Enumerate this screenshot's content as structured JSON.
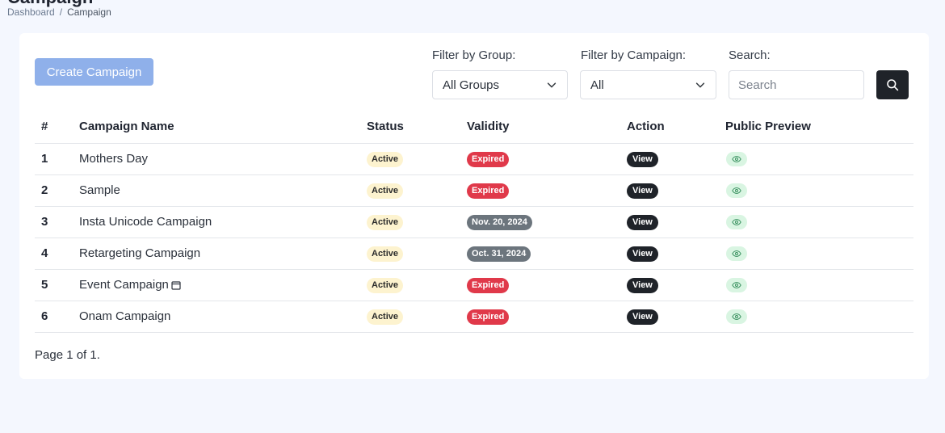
{
  "header": {
    "title": "Campaign",
    "breadcrumb": {
      "root": "Dashboard",
      "separator": "/",
      "current": "Campaign"
    }
  },
  "toolbar": {
    "create_label": "Create Campaign",
    "filter_group_label": "Filter by Group:",
    "filter_group_value": "All Groups",
    "filter_campaign_label": "Filter by Campaign:",
    "filter_campaign_value": "All",
    "search_label": "Search:",
    "search_placeholder": "Search",
    "search_icon": "search-icon"
  },
  "table": {
    "columns": [
      "#",
      "Campaign Name",
      "Status",
      "Validity",
      "Action",
      "Public Preview"
    ],
    "rows": [
      {
        "num": "1",
        "name": "Mothers Day",
        "status": "Active",
        "validity": "Expired",
        "validity_type": "expired",
        "action": "View",
        "calendar_icon": false
      },
      {
        "num": "2",
        "name": "Sample",
        "status": "Active",
        "validity": "Expired",
        "validity_type": "expired",
        "action": "View",
        "calendar_icon": false
      },
      {
        "num": "3",
        "name": "Insta Unicode Campaign",
        "status": "Active",
        "validity": "Nov. 20, 2024",
        "validity_type": "date",
        "action": "View",
        "calendar_icon": false
      },
      {
        "num": "4",
        "name": "Retargeting Campaign",
        "status": "Active",
        "validity": "Oct. 31, 2024",
        "validity_type": "date",
        "action": "View",
        "calendar_icon": false
      },
      {
        "num": "5",
        "name": "Event Campaign",
        "status": "Active",
        "validity": "Expired",
        "validity_type": "expired",
        "action": "View",
        "calendar_icon": true
      },
      {
        "num": "6",
        "name": "Onam Campaign",
        "status": "Active",
        "validity": "Expired",
        "validity_type": "expired",
        "action": "View",
        "calendar_icon": false
      }
    ]
  },
  "pagination": {
    "text": "Page 1 of 1."
  },
  "colors": {
    "create_button": "#8fb0ea",
    "active_badge": "#fdf3cf",
    "expired_badge": "#e0394a",
    "date_badge": "#6c757d",
    "view_badge": "#1f2329",
    "preview_badge": "#d9f5e2",
    "page_bg": "#f4f7fe"
  }
}
